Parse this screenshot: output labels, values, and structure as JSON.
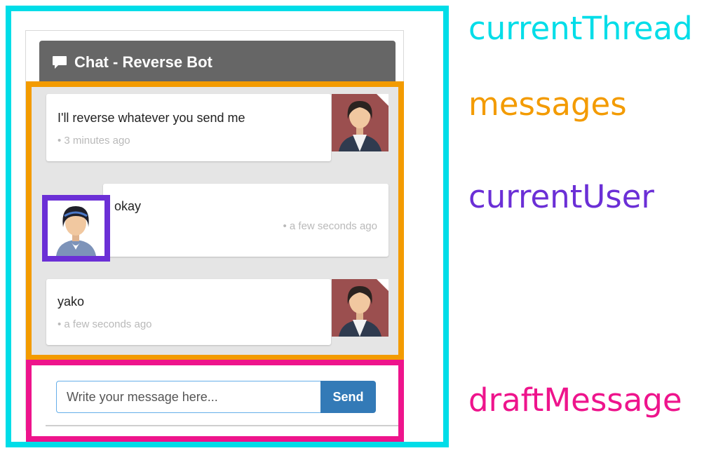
{
  "colors": {
    "current_thread": "#00dde8",
    "messages": "#f39b00",
    "current_user": "#6b2fd6",
    "draft_message": "#ee148c",
    "header_bg": "#666666",
    "send_button": "#337ab7"
  },
  "chat": {
    "title": "Chat - Reverse Bot",
    "icon": "chat-bubble-icon",
    "messages": [
      {
        "sender": "bot",
        "text": "I'll reverse whatever you send me",
        "time": "• 3 minutes ago"
      },
      {
        "sender": "user",
        "text": "okay",
        "time": "• a few seconds ago"
      },
      {
        "sender": "bot",
        "text": "yako",
        "time": "• a few seconds ago"
      }
    ]
  },
  "composer": {
    "placeholder": "Write your message here...",
    "send_label": "Send"
  },
  "legend": {
    "current_thread": "currentThread",
    "messages": "messages",
    "current_user": "currentUser",
    "draft_message": "draftMessage"
  }
}
